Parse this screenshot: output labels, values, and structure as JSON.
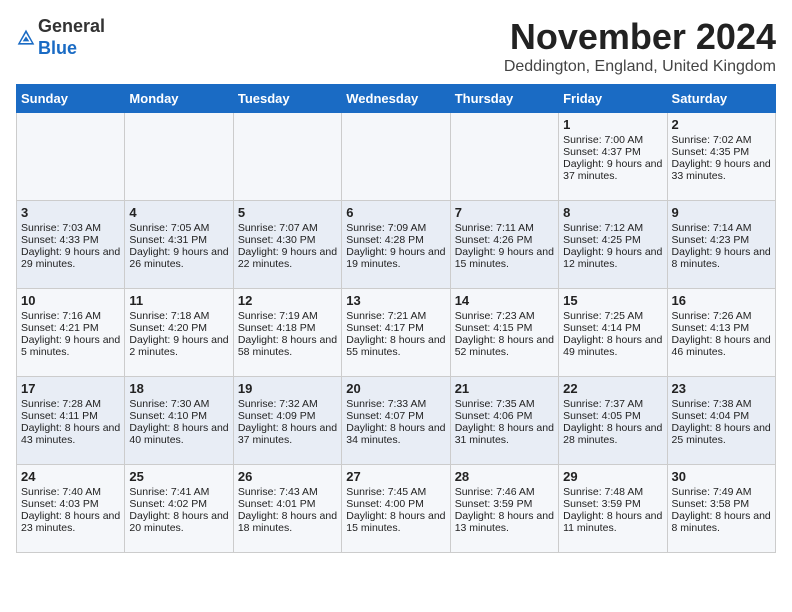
{
  "logo": {
    "general": "General",
    "blue": "Blue"
  },
  "header": {
    "month": "November 2024",
    "location": "Deddington, England, United Kingdom"
  },
  "days_of_week": [
    "Sunday",
    "Monday",
    "Tuesday",
    "Wednesday",
    "Thursday",
    "Friday",
    "Saturday"
  ],
  "weeks": [
    [
      {
        "day": "",
        "info": ""
      },
      {
        "day": "",
        "info": ""
      },
      {
        "day": "",
        "info": ""
      },
      {
        "day": "",
        "info": ""
      },
      {
        "day": "",
        "info": ""
      },
      {
        "day": "1",
        "info": "Sunrise: 7:00 AM\nSunset: 4:37 PM\nDaylight: 9 hours and 37 minutes."
      },
      {
        "day": "2",
        "info": "Sunrise: 7:02 AM\nSunset: 4:35 PM\nDaylight: 9 hours and 33 minutes."
      }
    ],
    [
      {
        "day": "3",
        "info": "Sunrise: 7:03 AM\nSunset: 4:33 PM\nDaylight: 9 hours and 29 minutes."
      },
      {
        "day": "4",
        "info": "Sunrise: 7:05 AM\nSunset: 4:31 PM\nDaylight: 9 hours and 26 minutes."
      },
      {
        "day": "5",
        "info": "Sunrise: 7:07 AM\nSunset: 4:30 PM\nDaylight: 9 hours and 22 minutes."
      },
      {
        "day": "6",
        "info": "Sunrise: 7:09 AM\nSunset: 4:28 PM\nDaylight: 9 hours and 19 minutes."
      },
      {
        "day": "7",
        "info": "Sunrise: 7:11 AM\nSunset: 4:26 PM\nDaylight: 9 hours and 15 minutes."
      },
      {
        "day": "8",
        "info": "Sunrise: 7:12 AM\nSunset: 4:25 PM\nDaylight: 9 hours and 12 minutes."
      },
      {
        "day": "9",
        "info": "Sunrise: 7:14 AM\nSunset: 4:23 PM\nDaylight: 9 hours and 8 minutes."
      }
    ],
    [
      {
        "day": "10",
        "info": "Sunrise: 7:16 AM\nSunset: 4:21 PM\nDaylight: 9 hours and 5 minutes."
      },
      {
        "day": "11",
        "info": "Sunrise: 7:18 AM\nSunset: 4:20 PM\nDaylight: 9 hours and 2 minutes."
      },
      {
        "day": "12",
        "info": "Sunrise: 7:19 AM\nSunset: 4:18 PM\nDaylight: 8 hours and 58 minutes."
      },
      {
        "day": "13",
        "info": "Sunrise: 7:21 AM\nSunset: 4:17 PM\nDaylight: 8 hours and 55 minutes."
      },
      {
        "day": "14",
        "info": "Sunrise: 7:23 AM\nSunset: 4:15 PM\nDaylight: 8 hours and 52 minutes."
      },
      {
        "day": "15",
        "info": "Sunrise: 7:25 AM\nSunset: 4:14 PM\nDaylight: 8 hours and 49 minutes."
      },
      {
        "day": "16",
        "info": "Sunrise: 7:26 AM\nSunset: 4:13 PM\nDaylight: 8 hours and 46 minutes."
      }
    ],
    [
      {
        "day": "17",
        "info": "Sunrise: 7:28 AM\nSunset: 4:11 PM\nDaylight: 8 hours and 43 minutes."
      },
      {
        "day": "18",
        "info": "Sunrise: 7:30 AM\nSunset: 4:10 PM\nDaylight: 8 hours and 40 minutes."
      },
      {
        "day": "19",
        "info": "Sunrise: 7:32 AM\nSunset: 4:09 PM\nDaylight: 8 hours and 37 minutes."
      },
      {
        "day": "20",
        "info": "Sunrise: 7:33 AM\nSunset: 4:07 PM\nDaylight: 8 hours and 34 minutes."
      },
      {
        "day": "21",
        "info": "Sunrise: 7:35 AM\nSunset: 4:06 PM\nDaylight: 8 hours and 31 minutes."
      },
      {
        "day": "22",
        "info": "Sunrise: 7:37 AM\nSunset: 4:05 PM\nDaylight: 8 hours and 28 minutes."
      },
      {
        "day": "23",
        "info": "Sunrise: 7:38 AM\nSunset: 4:04 PM\nDaylight: 8 hours and 25 minutes."
      }
    ],
    [
      {
        "day": "24",
        "info": "Sunrise: 7:40 AM\nSunset: 4:03 PM\nDaylight: 8 hours and 23 minutes."
      },
      {
        "day": "25",
        "info": "Sunrise: 7:41 AM\nSunset: 4:02 PM\nDaylight: 8 hours and 20 minutes."
      },
      {
        "day": "26",
        "info": "Sunrise: 7:43 AM\nSunset: 4:01 PM\nDaylight: 8 hours and 18 minutes."
      },
      {
        "day": "27",
        "info": "Sunrise: 7:45 AM\nSunset: 4:00 PM\nDaylight: 8 hours and 15 minutes."
      },
      {
        "day": "28",
        "info": "Sunrise: 7:46 AM\nSunset: 3:59 PM\nDaylight: 8 hours and 13 minutes."
      },
      {
        "day": "29",
        "info": "Sunrise: 7:48 AM\nSunset: 3:59 PM\nDaylight: 8 hours and 11 minutes."
      },
      {
        "day": "30",
        "info": "Sunrise: 7:49 AM\nSunset: 3:58 PM\nDaylight: 8 hours and 8 minutes."
      }
    ]
  ]
}
